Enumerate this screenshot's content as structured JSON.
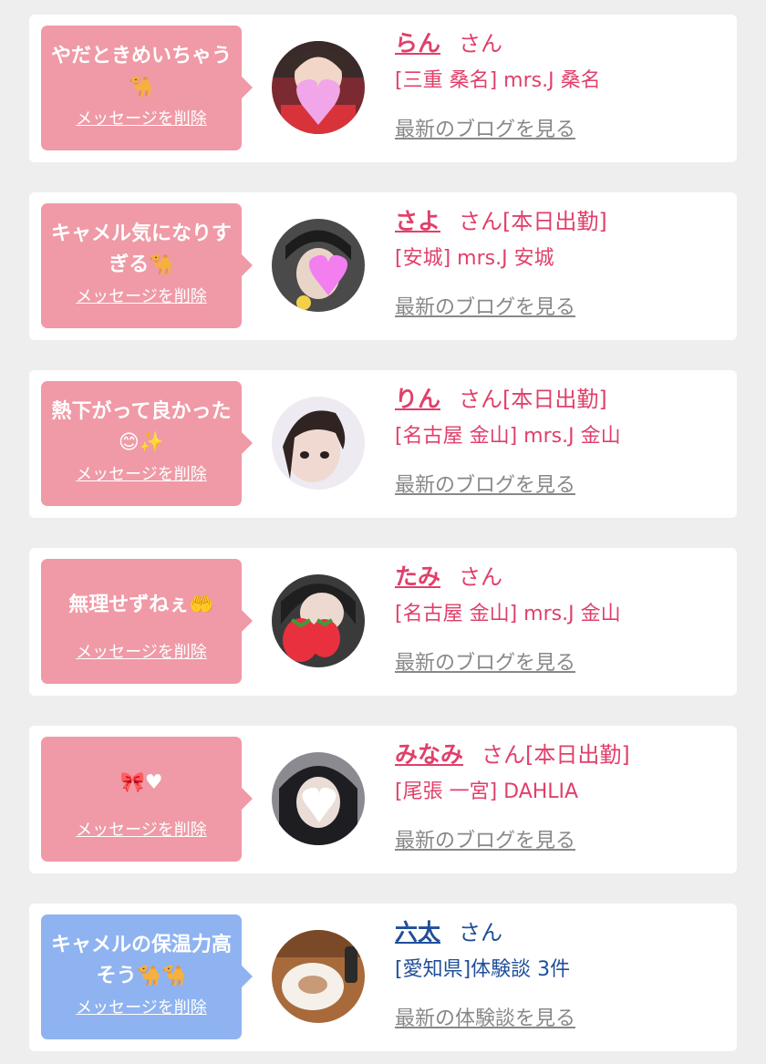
{
  "cards": [
    {
      "message": "やだときめいちゃう🐪",
      "delete_label": "メッセージを削除",
      "name": "らん",
      "san": "さん",
      "shop": "[三重 桑名] mrs.J 桑名",
      "blog_link": "最新のブログを見る",
      "theme": "pink"
    },
    {
      "message": "キャメル気になりすぎる🐪",
      "delete_label": "メッセージを削除",
      "name": "さよ",
      "san": "さん[本日出勤]",
      "shop": "[安城] mrs.J 安城",
      "blog_link": "最新のブログを見る",
      "theme": "pink"
    },
    {
      "message": "熱下がって良かった😊✨",
      "delete_label": "メッセージを削除",
      "name": "りん",
      "san": "さん[本日出勤]",
      "shop": "[名古屋 金山] mrs.J 金山",
      "blog_link": "最新のブログを見る",
      "theme": "pink"
    },
    {
      "message": "無理せずねぇ🤲",
      "delete_label": "メッセージを削除",
      "name": "たみ",
      "san": "さん",
      "shop": "[名古屋 金山] mrs.J 金山",
      "blog_link": "最新のブログを見る",
      "theme": "pink"
    },
    {
      "message": "🎀♥",
      "delete_label": "メッセージを削除",
      "name": "みなみ",
      "san": "さん[本日出勤]",
      "shop": "[尾張 一宮] DAHLIA",
      "blog_link": "最新のブログを見る",
      "theme": "pink"
    },
    {
      "message": "キャメルの保温力高そう🐪🐪",
      "delete_label": "メッセージを削除",
      "name": "六太",
      "san": "さん",
      "shop": "[愛知県]体験談 3件",
      "blog_link": "最新の体験談を見る",
      "theme": "blue"
    }
  ],
  "colors": {
    "pink_bubble": "#ef9aa6",
    "blue_bubble": "#8fb3f0",
    "pink_text": "#e0406a",
    "blue_text": "#1f4f9a",
    "link_gray": "#888888",
    "background": "#eeeeee"
  }
}
